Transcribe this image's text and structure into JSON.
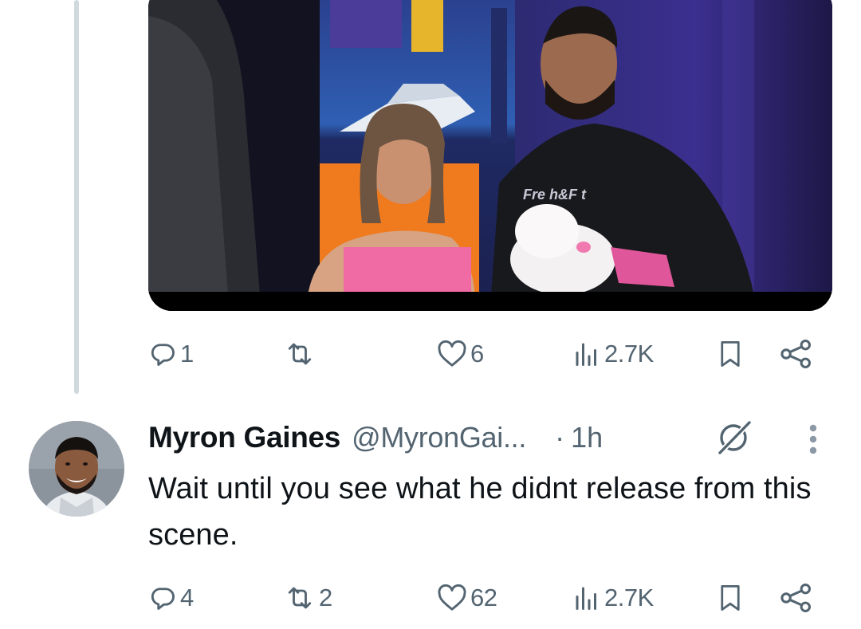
{
  "top_tweet": {
    "media_caption": "Fre h&F t",
    "actions": {
      "replies": "1",
      "reposts": "",
      "likes": "6",
      "views": "2.7K"
    }
  },
  "reply": {
    "author_name": "Myron Gaines",
    "handle": "@MyronGai...",
    "separator": "·",
    "time": "1h",
    "text": "Wait until you see what he didnt release from this scene.",
    "actions": {
      "replies": "4",
      "reposts": "2",
      "likes": "62",
      "views": "2.7K"
    }
  },
  "colors": {
    "icon_gray": "#536471",
    "thread_line": "#cfd9de",
    "text": "#0f1419"
  }
}
